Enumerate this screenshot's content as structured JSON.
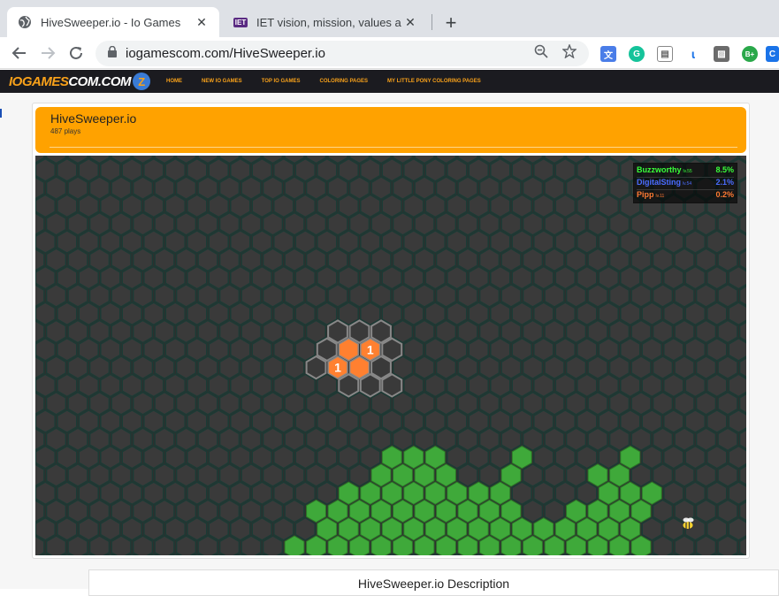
{
  "browser": {
    "tabs": [
      {
        "title": "HiveSweeper.io - Io Games",
        "active": true,
        "favicon": "globe-icon"
      },
      {
        "title": "IET vision, mission, values and be",
        "active": false,
        "favicon": "IET"
      }
    ],
    "url": "iogamescom.com/HiveSweeper.io",
    "extension_labels": {
      "b_plus": "B+"
    }
  },
  "site": {
    "logo": {
      "part1": "IOGAMES",
      "part2": "COM.COM",
      "badge": "Z"
    },
    "nav": [
      "HOME",
      "NEW IO GAMES",
      "TOP IO GAMES",
      "COLORING PAGES",
      "MY LITTLE PONY COLORING PAGES"
    ]
  },
  "game_page": {
    "title": "HiveSweeper.io",
    "plays": "487 plays",
    "description_heading": "HiveSweeper.io Description"
  },
  "leaderboard": [
    {
      "name": "Buzzworthy",
      "level": "lv.55",
      "percent": "8.5%",
      "color": "#39ff39"
    },
    {
      "name": "DigitalSting",
      "level": "lv.54",
      "percent": "2.1%",
      "color": "#4a6cff"
    },
    {
      "name": "Pipp",
      "level": "lv.11",
      "percent": "0.2%",
      "color": "#ff7a33"
    }
  ],
  "board": {
    "revealed_numbers": [
      "1",
      "1"
    ],
    "colors": {
      "empty": "#3a3a3a",
      "outline": "#1b3b35",
      "player": "#ff8030",
      "player_border": "#888888",
      "territory": "#3fa93a"
    }
  }
}
